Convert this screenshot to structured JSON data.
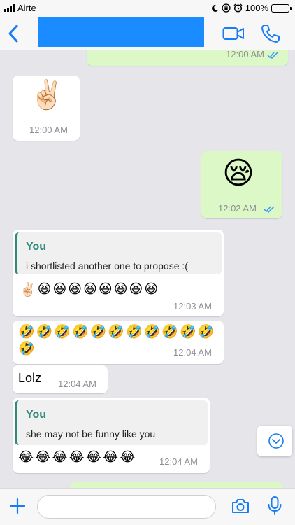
{
  "status_bar": {
    "carrier": "Airte",
    "battery": "100%",
    "battery_level": 1.0
  },
  "header": {
    "icons": [
      "chevron-left-icon",
      "video-call-icon",
      "phone-icon"
    ]
  },
  "colors": {
    "accent": "#1a7cf5",
    "incoming_bubble": "#ffffff",
    "outgoing_bubble": "#dcf8c6",
    "quote_name": "#2e8b7a",
    "chat_background": "#e5e5ea",
    "read_ticks": "#3497f9"
  },
  "messages": [
    {
      "direction": "out",
      "time": "12:00 AM",
      "read": true
    },
    {
      "direction": "in",
      "content": "✌🏻",
      "time": "12:00 AM"
    },
    {
      "direction": "out",
      "content": "😪",
      "time": "12:02 AM",
      "read": true
    },
    {
      "direction": "in",
      "quote": {
        "name": "You",
        "text": "i shortlisted another one to propose :("
      },
      "emojis": [
        "✌🏻",
        "😆",
        "😆",
        "😆",
        "😆",
        "😆",
        "😆",
        "😆",
        "😆"
      ],
      "time": "12:03 AM"
    },
    {
      "direction": "in",
      "emojis": [
        "🤣",
        "🤣",
        "🤣",
        "🤣",
        "🤣",
        "🤣",
        "🤣",
        "🤣",
        "🤣",
        "🤣",
        "🤣",
        "🤣"
      ],
      "time": "12:04 AM"
    },
    {
      "direction": "in",
      "text": "Lolz",
      "time": "12:04 AM"
    },
    {
      "direction": "in",
      "quote": {
        "name": "You",
        "text": "she may not be funny like you"
      },
      "emojis": [
        "😂",
        "😂",
        "😂",
        "😂",
        "😂",
        "😂",
        "😂"
      ],
      "time": "12:04 AM"
    }
  ],
  "input": {
    "placeholder": "",
    "value": ""
  }
}
